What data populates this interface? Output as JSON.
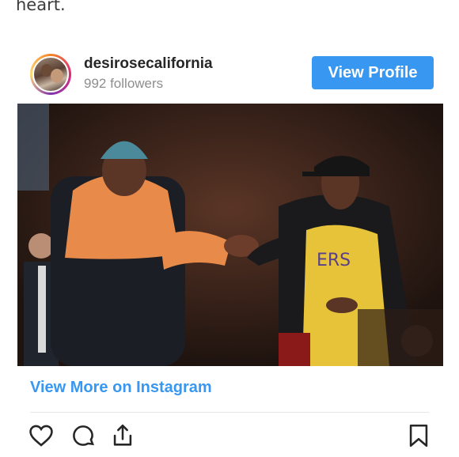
{
  "article": {
    "trailing_text": "heart."
  },
  "embed": {
    "username": "desirosecalifornia",
    "followers": "992 followers",
    "view_profile_label": "View Profile",
    "view_more_label": "View More on Instagram"
  },
  "icons": {
    "like": "heart-icon",
    "comment": "comment-icon",
    "share": "share-icon",
    "save": "bookmark-icon"
  },
  "colors": {
    "accent_blue": "#3897f0",
    "muted_gray": "#8e8e8e",
    "text_dark": "#262626"
  }
}
